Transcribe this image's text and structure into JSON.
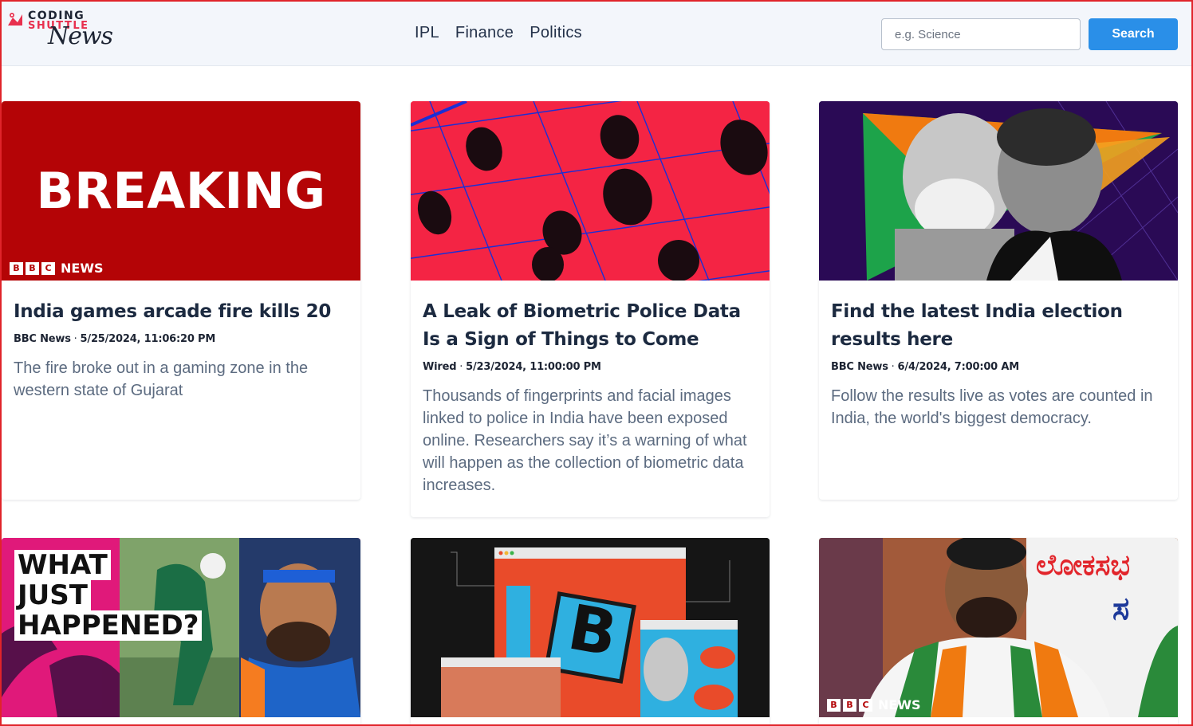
{
  "brand": {
    "line1": "CODING",
    "line2": "SHUTTLE",
    "script": "News"
  },
  "nav": {
    "items": [
      "IPL",
      "Finance",
      "Politics"
    ]
  },
  "search": {
    "placeholder": "e.g. Science",
    "value": "",
    "button_label": "Search",
    "button_color": "#2a8fe8"
  },
  "articles": [
    {
      "image_text": "BREAKING",
      "image_badge": "NEWS",
      "title": "India games arcade fire kills 20",
      "source": "BBC News",
      "published": "5/25/2024, 11:06:20 PM",
      "description": "The fire broke out in a gaming zone in the western state of Gujarat"
    },
    {
      "title": "A Leak of Biometric Police Data Is a Sign of Things to Come",
      "source": "Wired",
      "published": "5/23/2024, 11:00:00 PM",
      "description": "Thousands of fingerprints and facial images linked to police in India have been exposed online. Researchers say it’s a warning of what will happen as the collection of biometric data increases."
    },
    {
      "title": "Find the latest India election results here",
      "source": "BBC News",
      "published": "6/4/2024, 7:00:00 AM",
      "description": "Follow the results live as votes are counted in India, the world's biggest democracy."
    },
    {
      "image_text": [
        "WHAT",
        "JUST",
        "HAPPENED?"
      ]
    },
    {
      "image_text": "B"
    },
    {
      "image_text": "ಲೋಕಸಭ",
      "image_text2": "ಸ",
      "image_badge": "NEWS"
    }
  ],
  "bbc_letters": [
    "B",
    "B",
    "C"
  ]
}
